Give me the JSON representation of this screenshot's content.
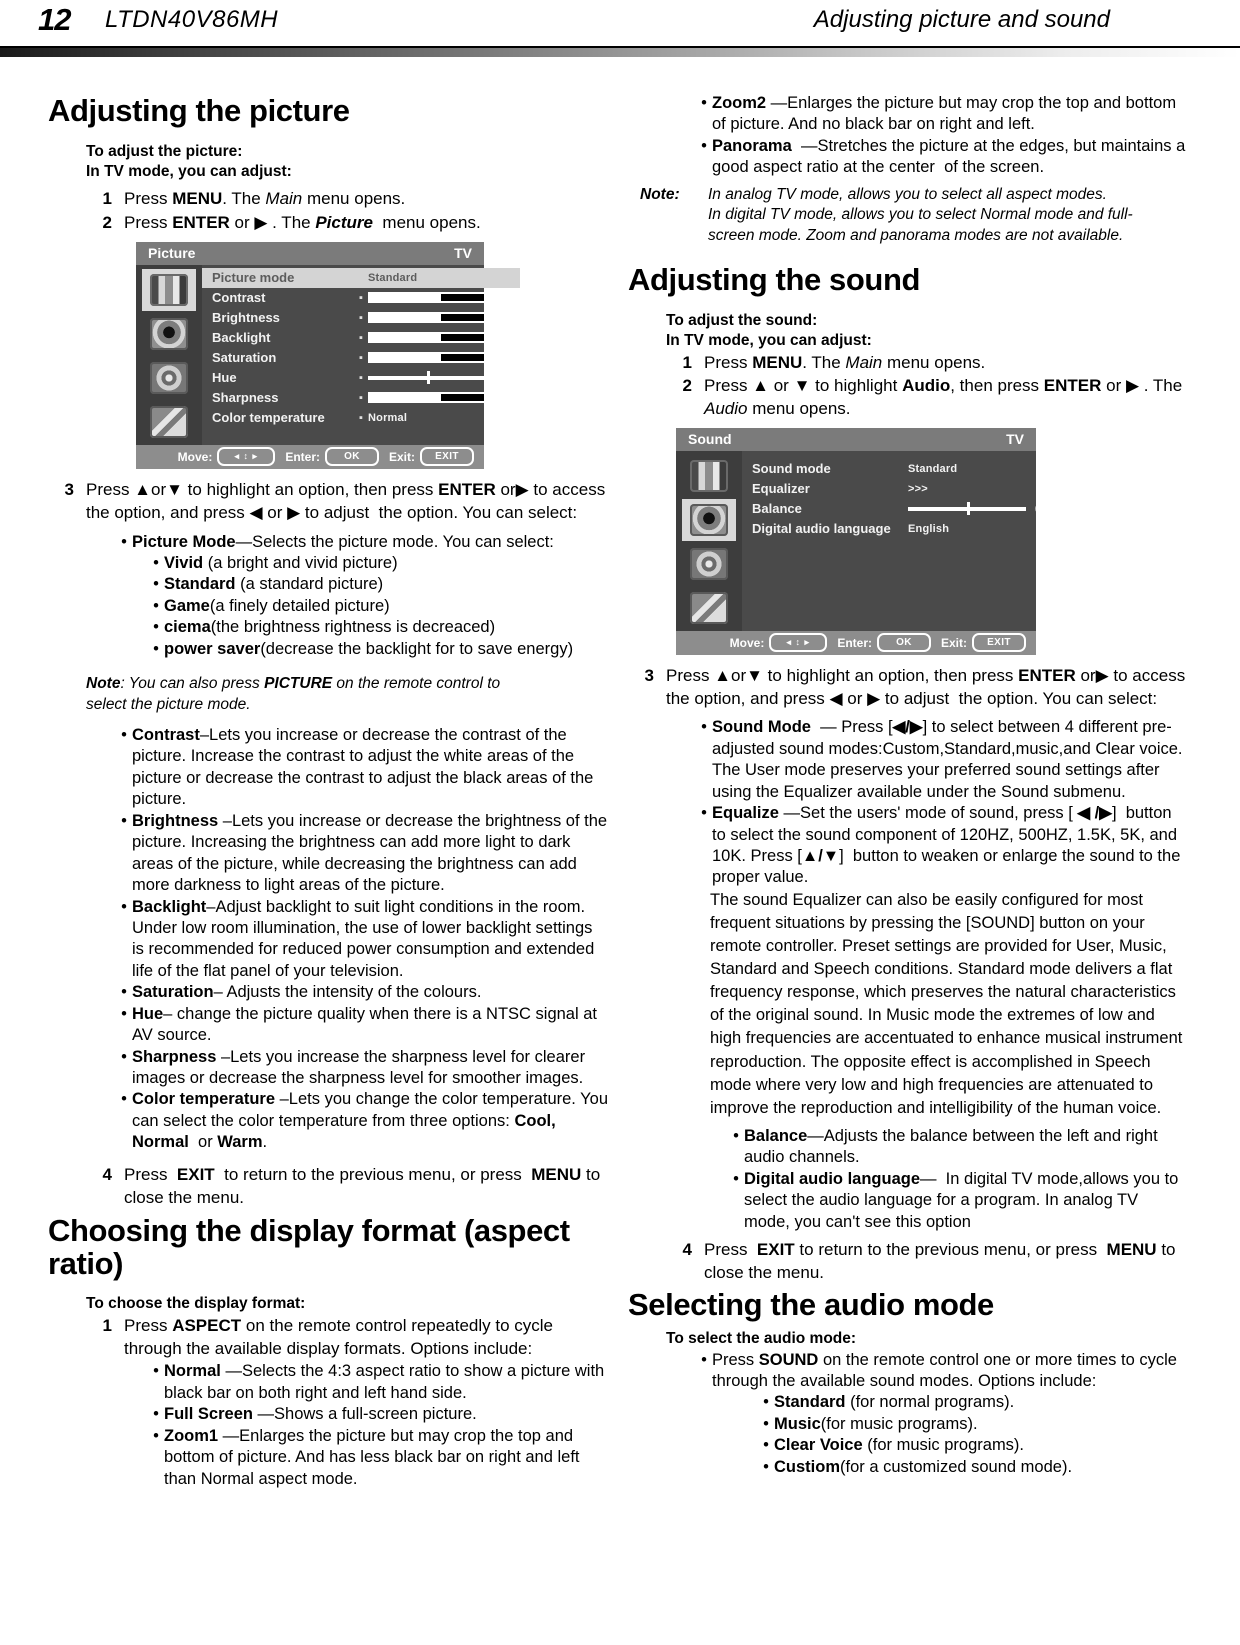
{
  "header": {
    "page_number": "12",
    "model": "LTDN40V86MH",
    "running_title": "Adjusting picture and sound"
  },
  "left_column": {
    "section_title": "Adjusting the picture",
    "intro_line1": "To adjust the picture:",
    "intro_line2": "In TV mode, you can adjust:",
    "steps": [
      {
        "num": "1",
        "text_html": "Press <b>MENU</b>. The <i>Main</i> menu opens."
      },
      {
        "num": "2",
        "text_html": "Press <b>ENTER</b> or ▶ . The <i><b>Picture</b></i>&nbsp; menu opens."
      }
    ],
    "picture_osd": {
      "title": "Picture",
      "source": "TV",
      "rows": [
        {
          "label": "Picture mode",
          "type": "value",
          "value": "Standard",
          "highlight": true,
          "mark": false
        },
        {
          "label": "Contrast",
          "type": "bar",
          "value": "50",
          "fill": 62,
          "mark": true
        },
        {
          "label": "Brightness",
          "type": "bar",
          "value": "50",
          "fill": 62,
          "mark": true
        },
        {
          "label": "Backlight",
          "type": "bar",
          "value": "5",
          "fill": 62,
          "mark": true
        },
        {
          "label": "Saturation",
          "type": "bar",
          "value": "50",
          "fill": 62,
          "mark": true
        },
        {
          "label": "Hue",
          "type": "center",
          "value": "0",
          "mark": true
        },
        {
          "label": "Sharpness",
          "type": "bar",
          "value": "5",
          "fill": 62,
          "mark": true
        },
        {
          "label": "Color temperature",
          "type": "value",
          "value": "Normal",
          "mark": true
        }
      ],
      "footer": {
        "move_label": "Move:",
        "move_key": "◂ ↕ ▸",
        "enter_label": "Enter:",
        "enter_key": "OK",
        "exit_label": "Exit:",
        "exit_key": "EXIT"
      }
    },
    "step3": {
      "num": "3",
      "text_html": "Press ▲or▼ to highlight an option, then press <b>ENTER</b> or▶ to access the option, and press ◀ or ▶ to adjust&nbsp; the option. You can select:"
    },
    "picture_mode_bullet": "Picture Mode",
    "picture_mode_desc": "—Selects the picture mode. You can select:",
    "picture_modes": [
      {
        "name": "Vivid",
        "desc": " (a bright and vivid picture)"
      },
      {
        "name": "Standard",
        "desc": " (a standard picture)"
      },
      {
        "name": "Game",
        "desc": "(a finely detailed picture)"
      },
      {
        "name": "ciema",
        "desc": "(the brightness rightness is decreaced)"
      },
      {
        "name": "power saver",
        "desc": "(decrease the backlight for to save energy)"
      }
    ],
    "note_picture_html": "<b>Note</b>: You can also press <b>PICTURE</b> on the remote control to select the picture mode.",
    "option_descriptions": [
      {
        "term": "Contrast",
        "sep": "–",
        "desc": "Lets you increase or decrease the contrast of the picture. Increase the contrast to adjust the white areas of the picture or decrease the contrast to adjust the black areas of the picture."
      },
      {
        "term": "Brightness",
        "sep": " –",
        "desc": "Lets you increase or decrease the brightness of the picture. Increasing the brightness can add more light to dark areas of the picture, while decreasing the brightness can add more darkness to light areas of the picture."
      },
      {
        "term": "Backlight",
        "sep": "–",
        "desc": "Adjust backlight to suit light conditions in the room. Under low room illumination, the use of lower backlight settings is recommended for reduced power consumption and extended life of the flat panel of your television."
      },
      {
        "term": "Saturation",
        "sep": "–",
        "desc": " Adjusts the intensity of the colours."
      },
      {
        "term": " Hue",
        "sep": "–",
        "desc": " change the picture quality when there is a NTSC signal at AV source."
      },
      {
        "term": "Sharpness",
        "sep": " –",
        "desc": "Lets you increase the sharpness level for clearer images or decrease the sharpness level for smoother images."
      }
    ],
    "color_temp_bullet": {
      "term": "Color temperature",
      "desc_html": " –Lets you change the color temperature. You can select the color temperature from three options: <b>Cool,&nbsp; Normal</b>&nbsp; or <b>Warm</b>."
    },
    "step4": {
      "num": "4",
      "text_html": "Press&nbsp; <b>EXIT</b>&nbsp; to return to the previous menu, or press&nbsp; <b>MENU</b> to close the menu."
    },
    "section_title2": "Choosing the display format (aspect ratio)",
    "intro2": "To choose the display format:",
    "step_aspect": {
      "num": "1",
      "text_html": "Press <b>ASPECT</b> on the remote control repeatedly to cycle through the available display formats. Options include:"
    },
    "aspect_options": [
      {
        "name": "Normal",
        "desc": " —Selects the 4:3 aspect ratio to show a picture with black bar on both right and left hand side."
      },
      {
        "name": "Full Screen",
        "desc": " —Shows a full-screen picture."
      },
      {
        "name": "Zoom1",
        "desc": " —Enlarges the picture but may crop the top and bottom of picture. And has less black bar on right and left than Normal aspect mode."
      }
    ]
  },
  "right_column": {
    "aspect_options_cont": [
      {
        "name": "Zoom2",
        "desc": " —Enlarges the picture but may crop the top and bottom of picture. And no black bar on right and left."
      },
      {
        "name": "Panorama",
        "desc": "&nbsp; —Stretches the picture at the edges, but maintains a good aspect ratio at the center&nbsp; of the screen."
      }
    ],
    "note_aspect": {
      "label": "Note:",
      "lines": [
        "In analog TV mode, allows you to select all aspect modes.",
        "In digital TV mode, allows you to select Normal mode and full-",
        "screen mode. Zoom and panorama modes are not available."
      ]
    },
    "section_title": "Adjusting the sound",
    "intro_line1": "To adjust the sound:",
    "intro_line2": "In TV mode, you can adjust:",
    "steps": [
      {
        "num": "1",
        "text_html": "Press <b>MENU</b>. The <i>Main</i> menu opens."
      },
      {
        "num": "2",
        "text_html": "Press ▲ or ▼ to highlight <b>Audio</b>, then press <b>ENTER</b> or ▶ . The <i>Audio</i> menu opens."
      }
    ],
    "sound_osd": {
      "title": "Sound",
      "source": "TV",
      "rows": [
        {
          "label": "Sound mode",
          "type": "value",
          "value": "Standard"
        },
        {
          "label": "Equalizer",
          "type": "value",
          "value": ">>>"
        },
        {
          "label": "Balance",
          "type": "center",
          "value": "0"
        },
        {
          "label": "Digital audio language",
          "type": "value",
          "value": "English"
        }
      ],
      "footer": {
        "move_label": "Move:",
        "move_key": "◂ ↕ ▸",
        "enter_label": "Enter:",
        "enter_key": "OK",
        "exit_label": "Exit:",
        "exit_key": "EXIT"
      }
    },
    "step3": {
      "num": "3",
      "text_html": "Press ▲or▼ to highlight an option, then press <b>ENTER</b> or▶ to access the option, and press ◀ or ▶ to adjust&nbsp; the option. You can select:"
    },
    "sound_options": [
      {
        "term": "Sound Mode",
        "desc_html": "&nbsp; — Press [<b>◀/▶</b>] to select between 4 different pre-adjusted sound modes:Custom,Standard,music,and Clear voice. The User mode preserves your preferred sound settings after using the Equalizer available under the Sound submenu."
      },
      {
        "term": "Equalize",
        "desc_html": " —Set the users' mode of sound, press [ <b>◀ /▶</b>]&nbsp; button to select the sound component of 120HZ, 500HZ, 1.5K, 5K, and 10K. Press [<b>▲/▼</b>]&nbsp; button to weaken or enlarge the sound to the proper value."
      }
    ],
    "equalizer_paragraph": "The sound Equalizer can also be easily configured for most frequent situations by pressing the [SOUND] button on your remote controller. Preset settings are provided for User, Music, Standard and Speech conditions. Standard mode delivers a flat frequency response, which preserves the natural characteristics of  the original sound. In Music mode the extremes of low and high frequencies are accentuated to enhance musical instrument reproduction. The opposite effect is accomplished in Speech mode where very low and high frequencies are attenuated to improve the reproduction and intelligibility of the human voice.",
    "sound_options2": [
      {
        "term": "Balance",
        "desc_html": "—Adjusts the balance between the left and right audio channels."
      },
      {
        "term": "Digital audio language",
        "desc_html": "—&nbsp; In digital TV mode,allows you to select the audio language for a program. In analog TV mode, you can't see this option"
      }
    ],
    "step4": {
      "num": "4",
      "text_html": "Press&nbsp; <b>EXIT</b> to return to the previous menu, or press&nbsp; <b>MENU</b> to close the menu."
    },
    "section_title2": "Selecting the audio mode",
    "intro2": "To select the audio mode:",
    "audio_mode_intro_html": "Press <b>SOUND</b> on the remote control one or more times to cycle through the available sound modes. Options include:",
    "audio_modes": [
      {
        "name": "Standard",
        "desc": " (for normal programs)."
      },
      {
        "name": "Music",
        "desc": "(for music programs)."
      },
      {
        "name": "Clear Voice",
        "desc": " (for music programs)."
      },
      {
        "name": "Custiom",
        "desc": "(for a customized sound mode)."
      }
    ]
  }
}
